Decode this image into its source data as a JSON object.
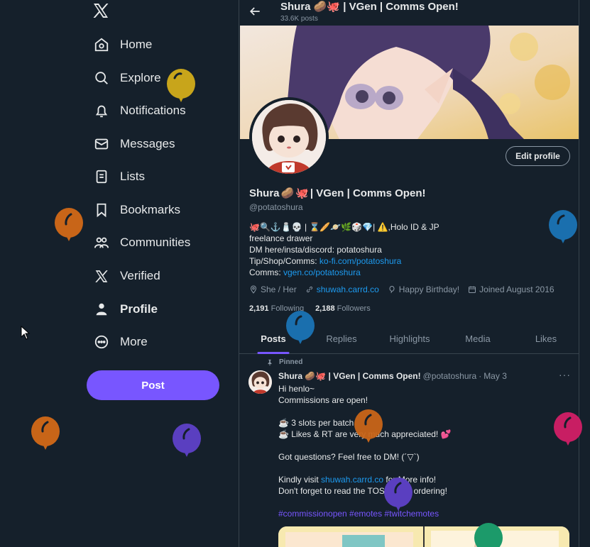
{
  "sidebar": {
    "logo": "x-logo-icon",
    "items": [
      {
        "label": "Home",
        "icon": "home-icon"
      },
      {
        "label": "Explore",
        "icon": "search-icon"
      },
      {
        "label": "Notifications",
        "icon": "bell-icon"
      },
      {
        "label": "Messages",
        "icon": "mail-icon"
      },
      {
        "label": "Lists",
        "icon": "list-icon"
      },
      {
        "label": "Bookmarks",
        "icon": "bookmark-icon"
      },
      {
        "label": "Communities",
        "icon": "communities-icon"
      },
      {
        "label": "Verified",
        "icon": "x-logo-icon"
      },
      {
        "label": "Profile",
        "icon": "person-icon"
      },
      {
        "label": "More",
        "icon": "more-circle-icon"
      }
    ],
    "post_label": "Post"
  },
  "header": {
    "name": "Shura 🥔🐙 | VGen | Comms Open!",
    "posts_count": "33.6K posts"
  },
  "profile": {
    "name_text": "Shura",
    "name_suffix": "| VGen | Comms Open!",
    "handle": "@potatoshura",
    "edit_label": "Edit profile",
    "bio_line1_emoji": "🐙🔍⚓🧂💀 | ⌛🥖🪐🌿🎲💎| ⚠️",
    "bio_line1_text": ",Holo ID & JP",
    "bio_line2": "freelance drawer",
    "bio_line3": "DM here/insta/discord: potatoshura",
    "bio_line4_prefix": "Tip/Shop/Comms: ",
    "bio_line4_link": "ko-fi.com/potatoshura",
    "bio_line5_prefix": "Comms: ",
    "bio_line5_link": "vgen.co/potatoshura",
    "pronouns": "She / Her",
    "website": "shuwah.carrd.co",
    "birthday": "Happy Birthday!",
    "joined": "Joined August 2016",
    "following_count": "2,191",
    "following_label": "Following",
    "followers_count": "2,188",
    "followers_label": "Followers"
  },
  "tabs": [
    "Posts",
    "Replies",
    "Highlights",
    "Media",
    "Likes"
  ],
  "tweet": {
    "pinned_label": "Pinned",
    "author_name": "Shura 🥔🐙 | VGen | Comms Open!",
    "author_handle": "@potatoshura",
    "dot": "·",
    "date": "May 3",
    "more": "···",
    "line1": "Hi henlo~",
    "line2": "Commissions are open!",
    "line3": "☕ 3 slots per batch",
    "line4": "☕ Likes & RT are very much appreciated! 💕",
    "line5": "Got questions? Feel free to DM! (´▽`)",
    "line6_prefix": "Kindly visit ",
    "line6_link": "shuwah.carrd.co",
    "line6_suffix": " for More info!",
    "line7": "Don't forget to read the TOS before ordering!",
    "hashtags": "#commissionopen #emotes #twitchemotes"
  },
  "colors": {
    "background": "#15202b",
    "accent": "#7856ff",
    "link": "#1d9bf0",
    "muted": "#8b98a5"
  }
}
